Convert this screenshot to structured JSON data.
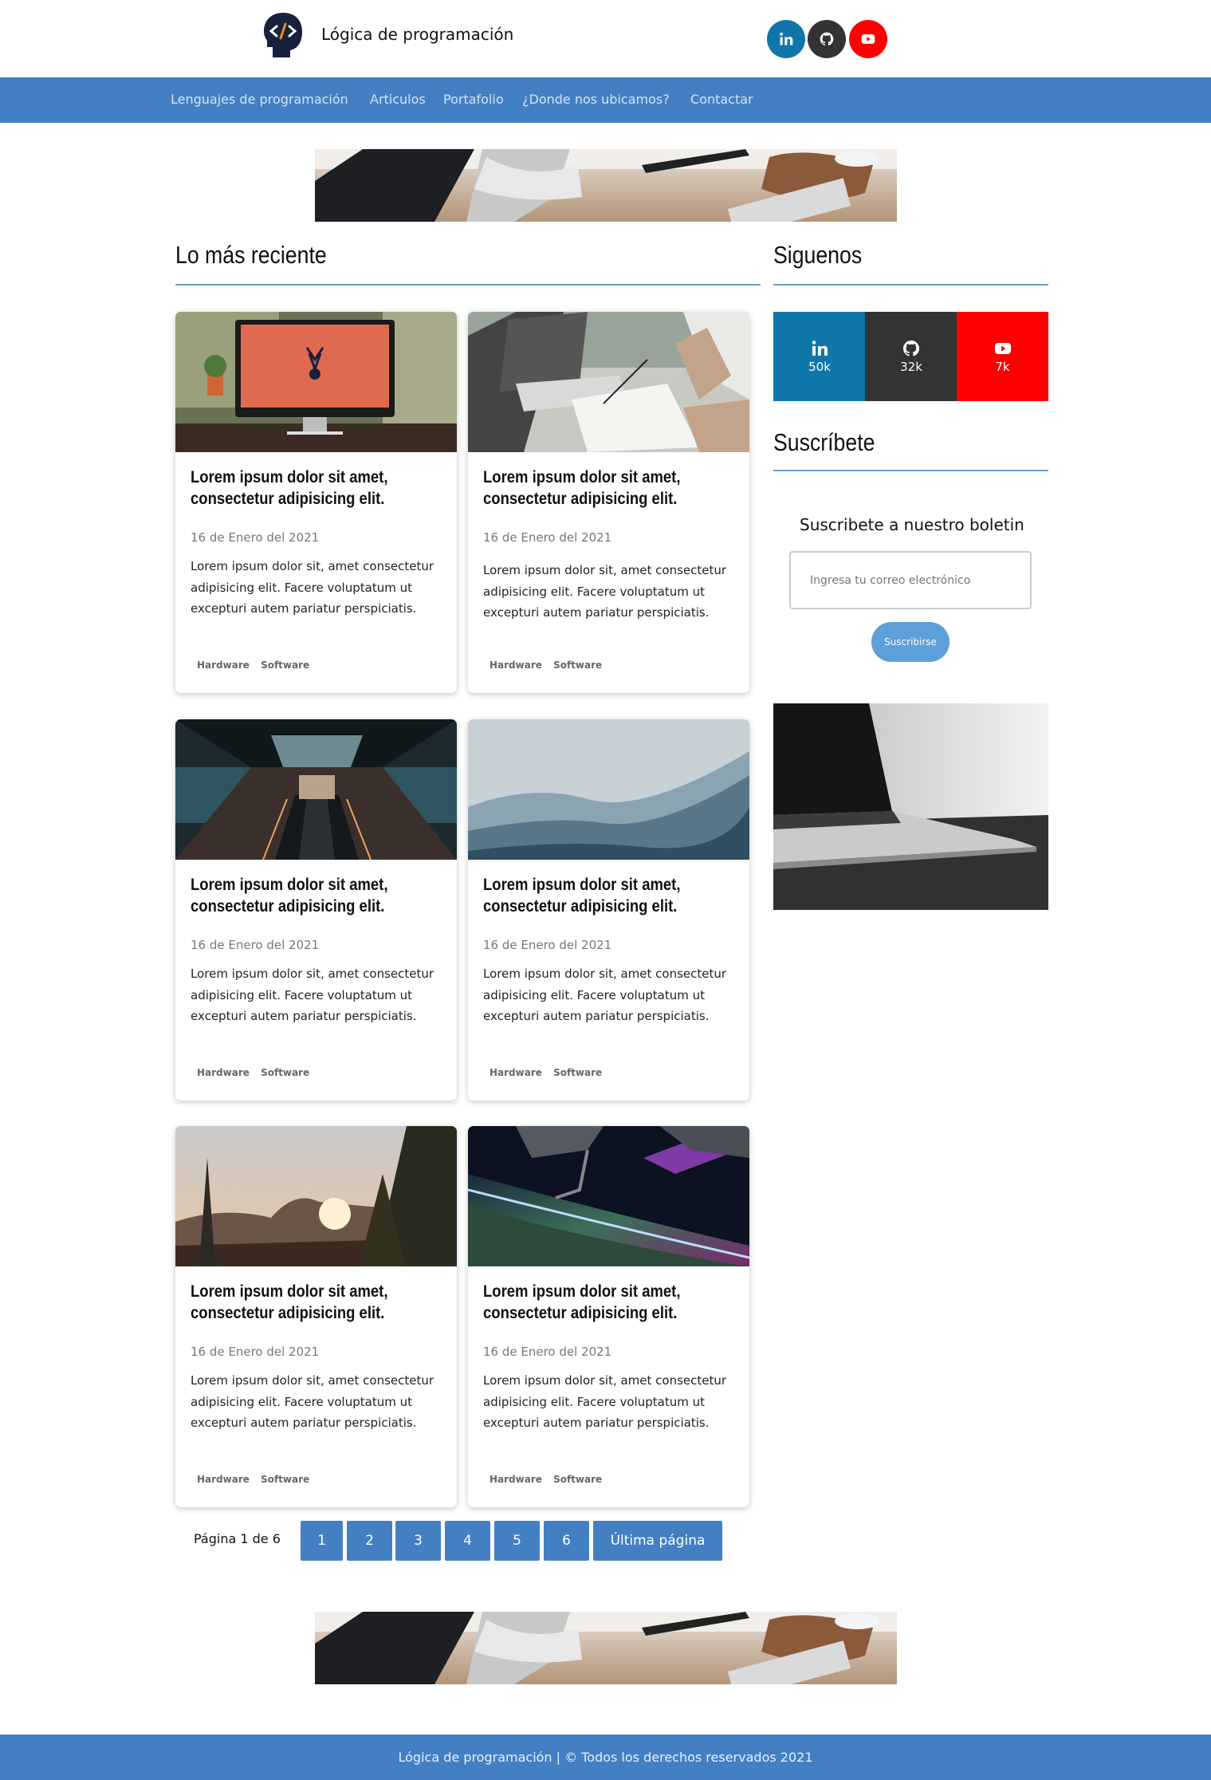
{
  "header": {
    "brand": "Lógica de programación",
    "logo_icon": "code-head-icon",
    "social": [
      {
        "name": "linkedin",
        "icon": "linkedin-icon",
        "color": "#0e76a8"
      },
      {
        "name": "github",
        "icon": "github-icon",
        "color": "#333333"
      },
      {
        "name": "youtube",
        "icon": "youtube-icon",
        "color": "#ff0000"
      }
    ]
  },
  "nav": {
    "items": [
      "Lenguajes de programación",
      "Articulos",
      "Portafolio",
      "¿Donde nos ubicamos?",
      "Contactar"
    ],
    "color": "#4380c3"
  },
  "main": {
    "section_title": "Lo más reciente",
    "cards": [
      {
        "image": "imac-desk",
        "title": "Lorem ipsum dolor sit amet, consectetur adipisicing elit.",
        "date": "16 de Enero del 2021",
        "text": "Lorem ipsum dolor sit, amet consectetur adipisicing elit. Facere voluptatum ut excepturi autem pariatur perspiciatis.",
        "tags": [
          "Hardware",
          "Software"
        ]
      },
      {
        "image": "laptop-notes",
        "title": "Lorem ipsum dolor sit amet, consectetur adipisicing elit.",
        "date": "16 de Enero del 2021",
        "text": "Lorem ipsum dolor sit, amet consectetur adipisicing elit. Facere voluptatum ut excepturi autem pariatur perspiciatis.",
        "tags": [
          "Hardware",
          "Software"
        ]
      },
      {
        "image": "escalator",
        "title": "Lorem ipsum dolor sit amet, consectetur adipisicing elit.",
        "date": "16 de Enero del 2021",
        "text": "Lorem ipsum dolor sit, amet consectetur adipisicing elit. Facere voluptatum ut excepturi autem pariatur perspiciatis.",
        "tags": [
          "Hardware",
          "Software"
        ]
      },
      {
        "image": "mountains-fog",
        "title": "Lorem ipsum dolor sit amet, consectetur adipisicing elit.",
        "date": "16 de Enero del 2021",
        "text": "Lorem ipsum dolor sit, amet consectetur adipisicing elit. Facere voluptatum ut excepturi autem pariatur perspiciatis.",
        "tags": [
          "Hardware",
          "Software"
        ]
      },
      {
        "image": "forest-sunset",
        "title": "Lorem ipsum dolor sit amet, consectetur adipisicing elit.",
        "date": "16 de Enero del 2021",
        "text": "Lorem ipsum dolor sit, amet consectetur adipisicing elit. Facere voluptatum ut excepturi autem pariatur perspiciatis.",
        "tags": [
          "Hardware",
          "Software"
        ]
      },
      {
        "image": "space-station-aurora",
        "title": "Lorem ipsum dolor sit amet, consectetur adipisicing elit.",
        "date": "16 de Enero del 2021",
        "text": "Lorem ipsum dolor sit, amet consectetur adipisicing elit. Facere voluptatum ut excepturi autem pariatur perspiciatis.",
        "tags": [
          "Hardware",
          "Software"
        ]
      }
    ]
  },
  "sidebar": {
    "follow_title": "Siguenos",
    "social": [
      {
        "icon": "linkedin-icon",
        "count": "50k",
        "color": "#0e76a8"
      },
      {
        "icon": "github-icon",
        "count": "32k",
        "color": "#333333"
      },
      {
        "icon": "youtube-icon",
        "count": "7k",
        "color": "#ff0000"
      }
    ],
    "subscribe_title": "Suscríbete",
    "newsletter_title": "Suscribete a nuestro boletin",
    "email_placeholder": "Ingresa tu correo electrónico",
    "subscribe_button": "Suscribirse"
  },
  "pagination": {
    "label": "Página 1 de 6",
    "pages": [
      "1",
      "2",
      "3",
      "4",
      "5",
      "6"
    ],
    "last": "Última página"
  },
  "footer": {
    "text": "Lógica de programación | © Todos los derechos reservados 2021"
  }
}
